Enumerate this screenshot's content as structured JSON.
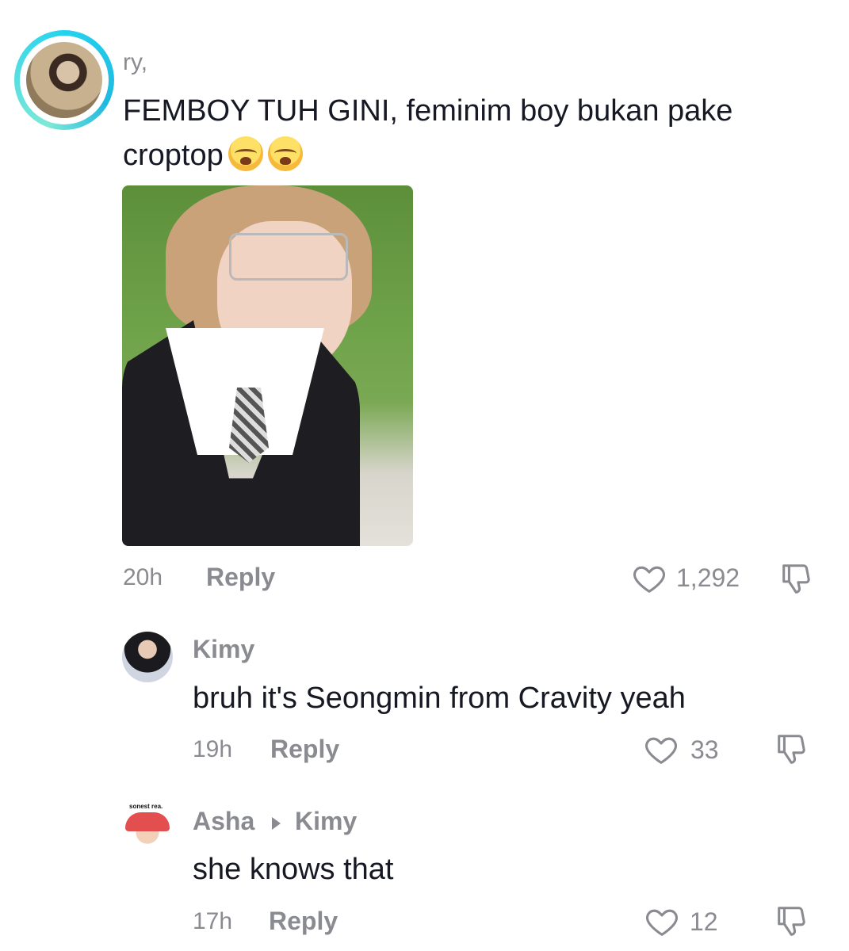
{
  "main_comment": {
    "username": "ry,",
    "text": "FEMBOY TUH GINI, feminim boy bukan pake croptop",
    "emojis": [
      "loudly-crying-face",
      "loudly-crying-face"
    ],
    "time": "20h",
    "reply_label": "Reply",
    "likes": "1,292"
  },
  "replies": [
    {
      "username": "Kimy",
      "text": "bruh it's Seongmin from Cravity yeah",
      "time": "19h",
      "reply_label": "Reply",
      "likes": "33"
    },
    {
      "username": "Asha",
      "reply_to": "Kimy",
      "avatar_tag": "sonest rea.",
      "text": "she knows that",
      "time": "17h",
      "reply_label": "Reply",
      "likes": "12"
    }
  ],
  "colors": {
    "text_primary": "#161823",
    "text_secondary": "#8a8b91",
    "avatar_ring": "#25d3ee",
    "background": "#ffffff"
  }
}
